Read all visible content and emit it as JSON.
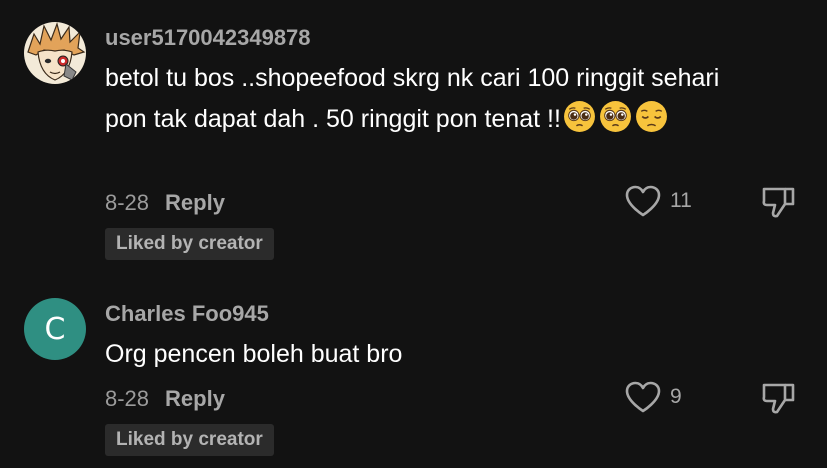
{
  "comments": [
    {
      "username": "user5170042349878",
      "avatar_icon": "anime-character-avatar",
      "text": "betol tu bos ..shopeefood skrg nk cari 100 ringgit sehari pon tak dapat dah . 50 ringgit pon tenat !!",
      "emojis": [
        "pleading-face-emoji",
        "pleading-face-emoji",
        "pensive-face-emoji"
      ],
      "date": "8-28",
      "reply_label": "Reply",
      "like_count": "11",
      "badge": "Liked by creator"
    },
    {
      "username": "Charles Foo945",
      "avatar_letter": "C",
      "avatar_color": "#2f8f82",
      "text": "Org pencen boleh buat bro",
      "date": "8-28",
      "reply_label": "Reply",
      "like_count": "9",
      "badge": "Liked by creator"
    }
  ],
  "colors": {
    "background": "#121212",
    "secondary_text": "#a7a7a7",
    "badge_bg": "#2b2b2b"
  }
}
